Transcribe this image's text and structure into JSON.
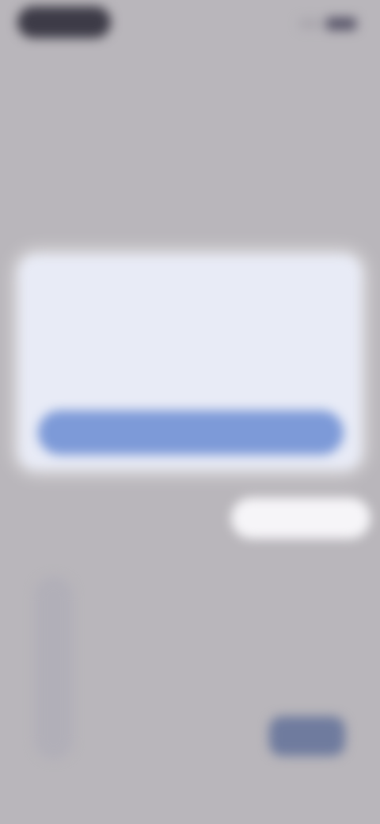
{
  "status_bar": {
    "time": ""
  },
  "header": {
    "top_link": "",
    "title_lead": "",
    "title_main": "",
    "title_second_line": "",
    "subtitle": ""
  },
  "section": {
    "label": ""
  },
  "dialog": {
    "title": "",
    "body": "",
    "button_label": ""
  },
  "controls": {
    "row_label": "",
    "row_hint": "",
    "input_placeholder": ""
  },
  "keypad": {
    "keys": [
      "",
      "",
      "",
      "",
      "",
      "",
      "",
      "",
      ""
    ]
  },
  "colors": {
    "background": "#b9b6bb",
    "card": "#e8ebf6",
    "primary_button": "#7d9ad8",
    "accent_key": "#6f7b9e"
  }
}
